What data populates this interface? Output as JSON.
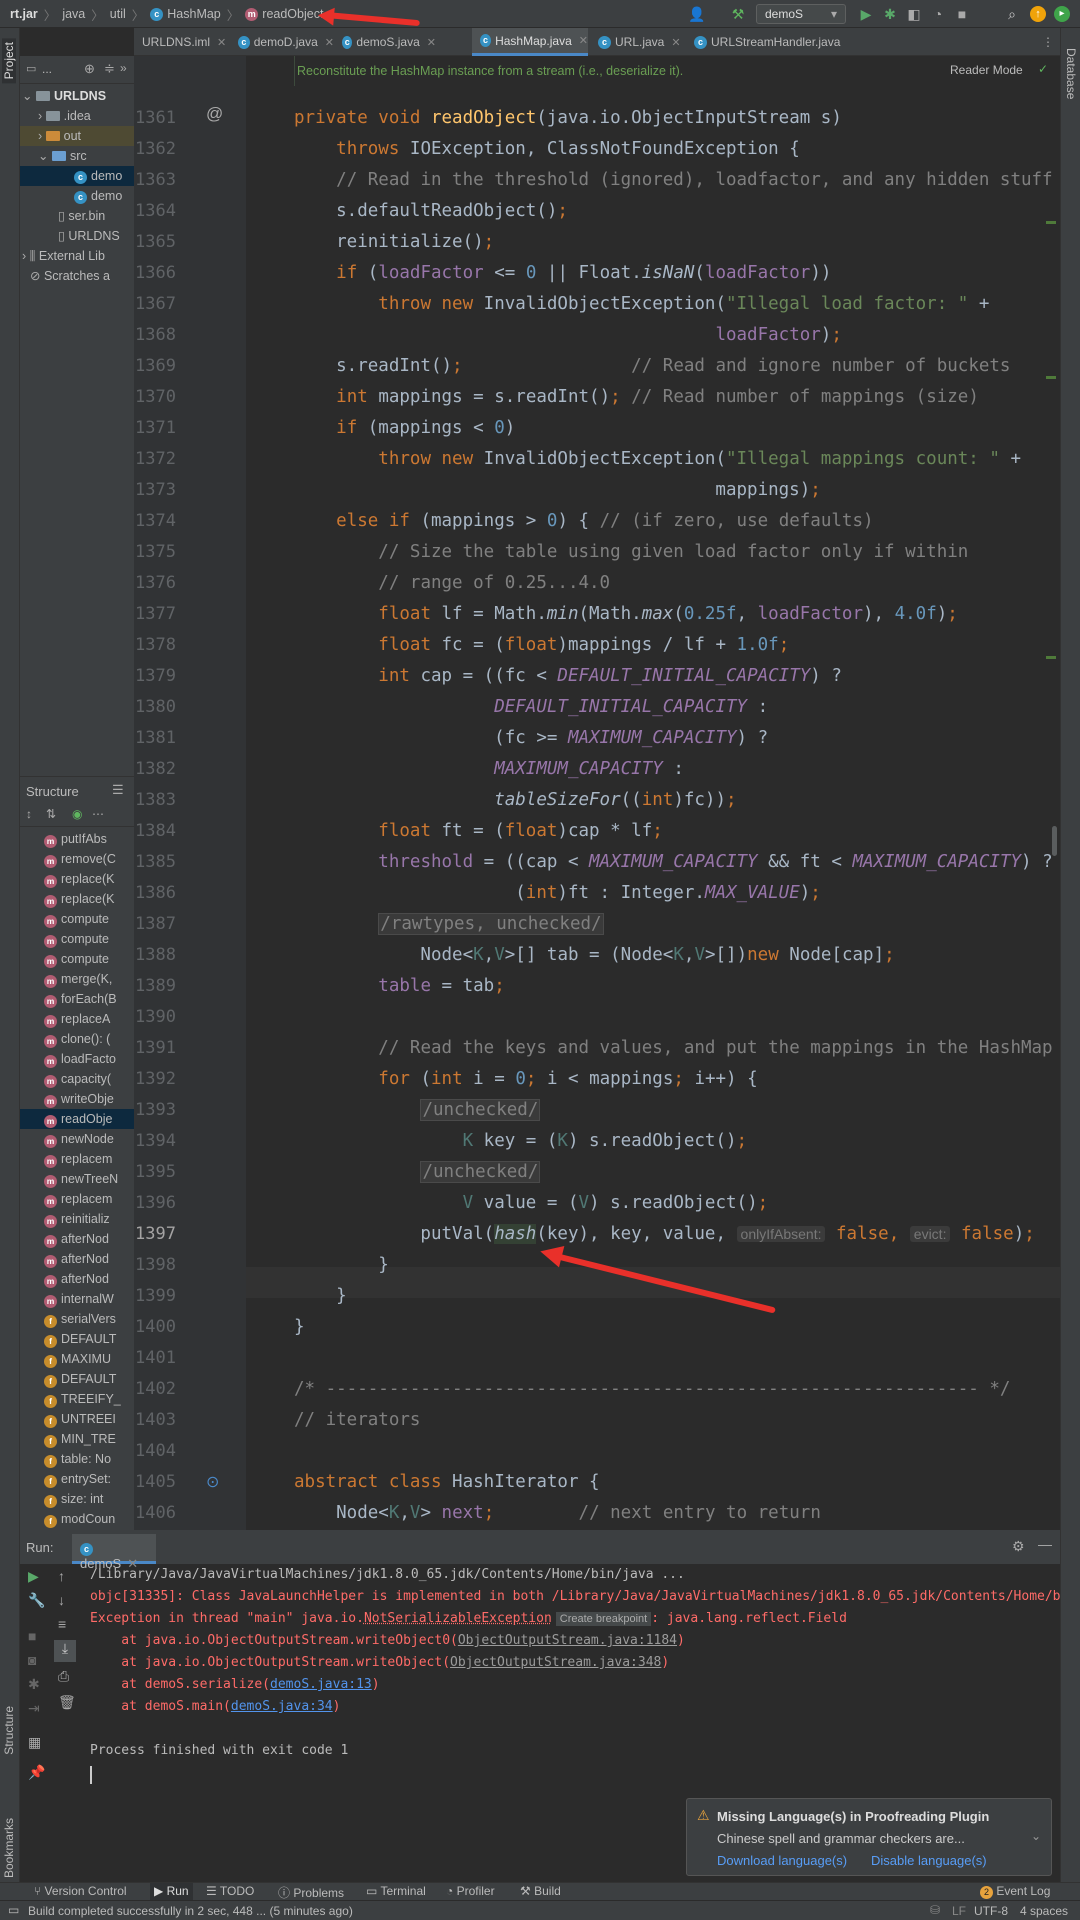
{
  "breadcrumb": [
    "rt.jar",
    "java",
    "util",
    "HashMap",
    "readObject"
  ],
  "run_config": "demoS",
  "tabs": [
    "URLDNS.iml",
    "demoD.java",
    "demoS.java",
    "HashMap.java",
    "URL.java",
    "URLStreamHandler.java"
  ],
  "active_tab": "HashMap.java",
  "reader_mode": "Reader Mode",
  "doc_comment": "Reconstitute the HashMap instance from a stream (i.e., deserialize it).",
  "left_strip": {
    "project": "Project",
    "structure": "Structure",
    "bookmarks": "Bookmarks"
  },
  "right_strip": {
    "database": "Database"
  },
  "project_panel": {
    "title": "...",
    "items": [
      "URLDNS",
      ".idea",
      "out",
      "src",
      "demo",
      "demo",
      "ser.bin",
      "URLDNS",
      "External Lib",
      "Scratches a"
    ]
  },
  "structure_panel": {
    "title": "Structure",
    "items": [
      "putIfAbs",
      "remove(C",
      "replace(K",
      "replace(K",
      "compute",
      "compute",
      "compute",
      "merge(K,",
      "forEach(B",
      "replaceA",
      "clone(): (",
      "loadFacto",
      "capacity(",
      "writeObje",
      "readObje",
      "newNode",
      "replacem",
      "newTreeN",
      "replacem",
      "reinitializ",
      "afterNod",
      "afterNod",
      "afterNod",
      "internalW",
      "serialVers",
      "DEFAULT",
      "MAXIMU",
      "DEFAULT",
      "TREEIFY_",
      "UNTREEI",
      "MIN_TRE",
      "table: No",
      "entrySet:",
      "size: int",
      "modCoun"
    ]
  },
  "line_numbers": [
    1361,
    1362,
    1363,
    1364,
    1365,
    1366,
    1367,
    1368,
    1369,
    1370,
    1371,
    1372,
    1373,
    1374,
    1375,
    1376,
    1377,
    1378,
    1379,
    1380,
    1381,
    1382,
    1383,
    1384,
    1385,
    1386,
    1387,
    1388,
    1389,
    1390,
    1391,
    1392,
    1393,
    1394,
    1395,
    1396,
    1397,
    1398,
    1399,
    1400,
    1401,
    1402,
    1403,
    1404,
    1405,
    1406
  ],
  "run_panel": {
    "label": "Run:",
    "tab": "demoS",
    "console": [
      "/Library/Java/JavaVirtualMachines/jdk1.8.0_65.jdk/Contents/Home/bin/java ...",
      "objc[31335]: Class JavaLaunchHelper is implemented in both /Library/Java/JavaVirtualMachines/jdk1.8.0_65.jdk/Contents/Home/b",
      "Exception in thread \"main\" java.io.",
      "NotSerializableException",
      "Create breakpoint",
      ": java.lang.reflect.Field",
      "    at java.io.ObjectOutputStream.writeObject0(",
      "ObjectOutputStream.java:1184",
      "    at java.io.ObjectOutputStream.writeObject(",
      "ObjectOutputStream.java:348",
      "    at demoS.serialize(",
      "demoS.java:13",
      "    at demoS.main(",
      "demoS.java:34",
      "Process finished with exit code 1"
    ]
  },
  "notification": {
    "title": "Missing Language(s) in Proofreading Plugin",
    "body": "Chinese spell and grammar checkers are...",
    "action1": "Download language(s)",
    "action2": "Disable language(s)"
  },
  "bottom_tabs": [
    "Version Control",
    "Run",
    "TODO",
    "Problems",
    "Terminal",
    "Profiler",
    "Build"
  ],
  "event_log": {
    "count": "2",
    "label": "Event Log"
  },
  "status": {
    "message": "Build completed successfully in 2 sec, 448 ... (5 minutes ago)",
    "lf": "LF",
    "encoding": "UTF-8",
    "indent": "4 spaces"
  },
  "colors": {
    "annotation_arrow": "#e9302a",
    "active_tab_underline": "#4a88c7",
    "keyword": "#cc7832"
  }
}
